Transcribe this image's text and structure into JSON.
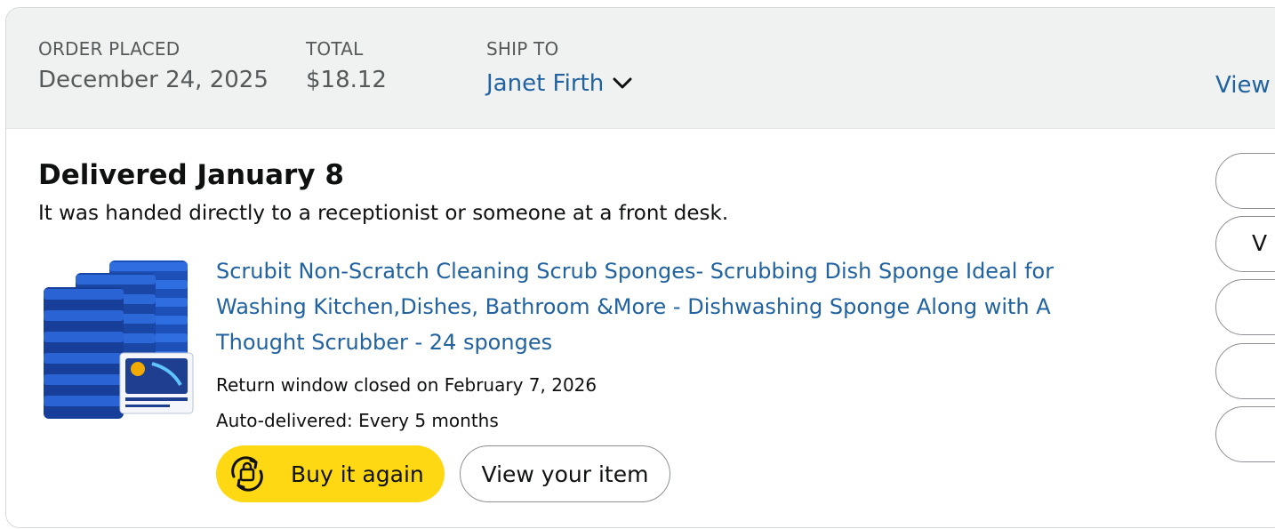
{
  "header": {
    "order_placed_label": "ORDER PLACED",
    "order_placed_value": "December 24, 2025",
    "total_label": "TOTAL",
    "total_value": "$18.12",
    "ship_to_label": "SHIP TO",
    "ship_to_name": "Janet Firth",
    "view_link": "View"
  },
  "shipment": {
    "status": "Delivered January 8",
    "note": "It was handed directly to a receptionist or someone at a front desk."
  },
  "item": {
    "title": "Scrubit Non-Scratch Cleaning Scrub Sponges- Scrubbing Dish Sponge Ideal for Washing Kitchen,Dishes, Bathroom &More - Dishwashing Sponge Along with A Thought Scrubber - 24 sponges",
    "return_window": "Return window closed on February 7, 2026",
    "auto_delivered": "Auto-delivered: Every 5 months",
    "image_icon": "sponge-product-image"
  },
  "actions": {
    "buy_again_label": "Buy it again",
    "buy_again_icon": "reorder-icon",
    "view_item_label": "View your item"
  },
  "side_buttons": [
    "",
    "V",
    "",
    "",
    ""
  ],
  "colors": {
    "header_bg": "#f0f2f2",
    "link": "#2162a1",
    "buy_button": "#ffd814",
    "border": "#d5d9d9"
  }
}
